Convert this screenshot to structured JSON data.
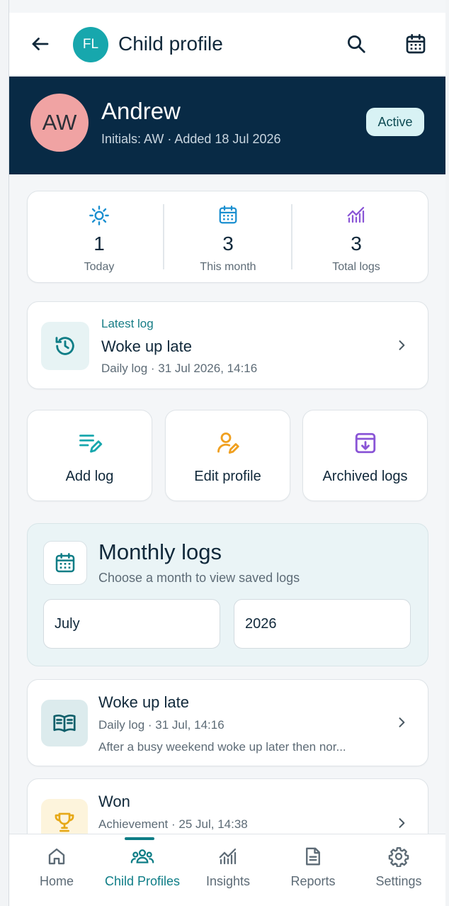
{
  "header": {
    "title": "Child profile",
    "initials": "FL"
  },
  "profile": {
    "initials": "AW",
    "name": "Andrew",
    "subtitle": "Initials: AW · Added 18 Jul 2026",
    "status": "Active"
  },
  "stats": [
    {
      "value": "1",
      "label": "Today",
      "icon": "sun-icon"
    },
    {
      "value": "3",
      "label": "This month",
      "icon": "calendar-icon"
    },
    {
      "value": "3",
      "label": "Total logs",
      "icon": "chart-icon"
    }
  ],
  "latest_log": {
    "kicker": "Latest log",
    "title": "Woke up late",
    "meta": "Daily log · 31 Jul 2026, 14:16"
  },
  "actions": [
    {
      "label": "Add log",
      "icon": "add-log-icon"
    },
    {
      "label": "Edit profile",
      "icon": "edit-profile-icon"
    },
    {
      "label": "Archived logs",
      "icon": "archive-icon"
    }
  ],
  "monthly": {
    "title": "Monthly logs",
    "subtitle": "Choose a month to view saved logs",
    "month": "July",
    "year": "2026"
  },
  "logs": [
    {
      "title": "Woke up late",
      "meta": "Daily log · 31 Jul, 14:16",
      "description": "After a busy weekend woke up later then nor...",
      "icon": "book-icon"
    },
    {
      "title": "Won",
      "meta": "Achievement · 25 Jul, 14:38",
      "description": "",
      "icon": "trophy-icon"
    }
  ],
  "nav": [
    {
      "label": "Home",
      "icon": "home-icon"
    },
    {
      "label": "Child Profiles",
      "icon": "people-icon"
    },
    {
      "label": "Insights",
      "icon": "insights-icon"
    },
    {
      "label": "Reports",
      "icon": "report-icon"
    },
    {
      "label": "Settings",
      "icon": "gear-icon"
    }
  ],
  "colors": {
    "accent": "#0e7d86",
    "hero": "#082a45",
    "avatar": "#f0a3a3",
    "badge": "#d8f2f4"
  }
}
